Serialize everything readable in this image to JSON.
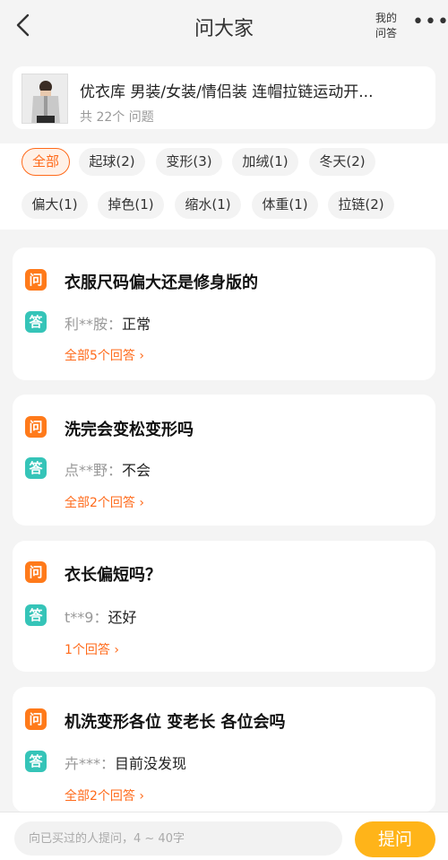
{
  "header": {
    "title": "问大家",
    "my_answers_line1": "我的",
    "my_answers_line2": "问答",
    "more": "•••"
  },
  "product": {
    "name": "优衣库 男装/女装/情侣装 连帽拉链运动开...",
    "question_count": "共 22个 问题"
  },
  "tags": [
    {
      "label": "全部",
      "active": true
    },
    {
      "label": "起球(2)"
    },
    {
      "label": "变形(3)"
    },
    {
      "label": "加绒(1)"
    },
    {
      "label": "冬天(2)"
    },
    {
      "label": "偏大(1)"
    },
    {
      "label": "掉色(1)"
    },
    {
      "label": "缩水(1)"
    },
    {
      "label": "体重(1)"
    },
    {
      "label": "拉链(2)"
    }
  ],
  "badges": {
    "question": "问",
    "answer": "答"
  },
  "questions": [
    {
      "question": "衣服尺码偏大还是修身版的",
      "user": "利**胺：",
      "answer": "正常",
      "link": "全部5个回答 ›"
    },
    {
      "question": "洗完会变松变形吗",
      "user": "点**野：",
      "answer": "不会",
      "link": "全部2个回答 ›"
    },
    {
      "question": "衣长偏短吗？",
      "user": "t**9：",
      "answer": "还好",
      "link": "1个回答 ›"
    },
    {
      "question": "机洗变形各位 变老长 各位会吗",
      "user": "卉***：",
      "answer": "目前没发现",
      "link": "全部2个回答 ›"
    }
  ],
  "ask_bar": {
    "placeholder": "向已买过的人提问，4 ~ 40字",
    "button": "提问"
  }
}
